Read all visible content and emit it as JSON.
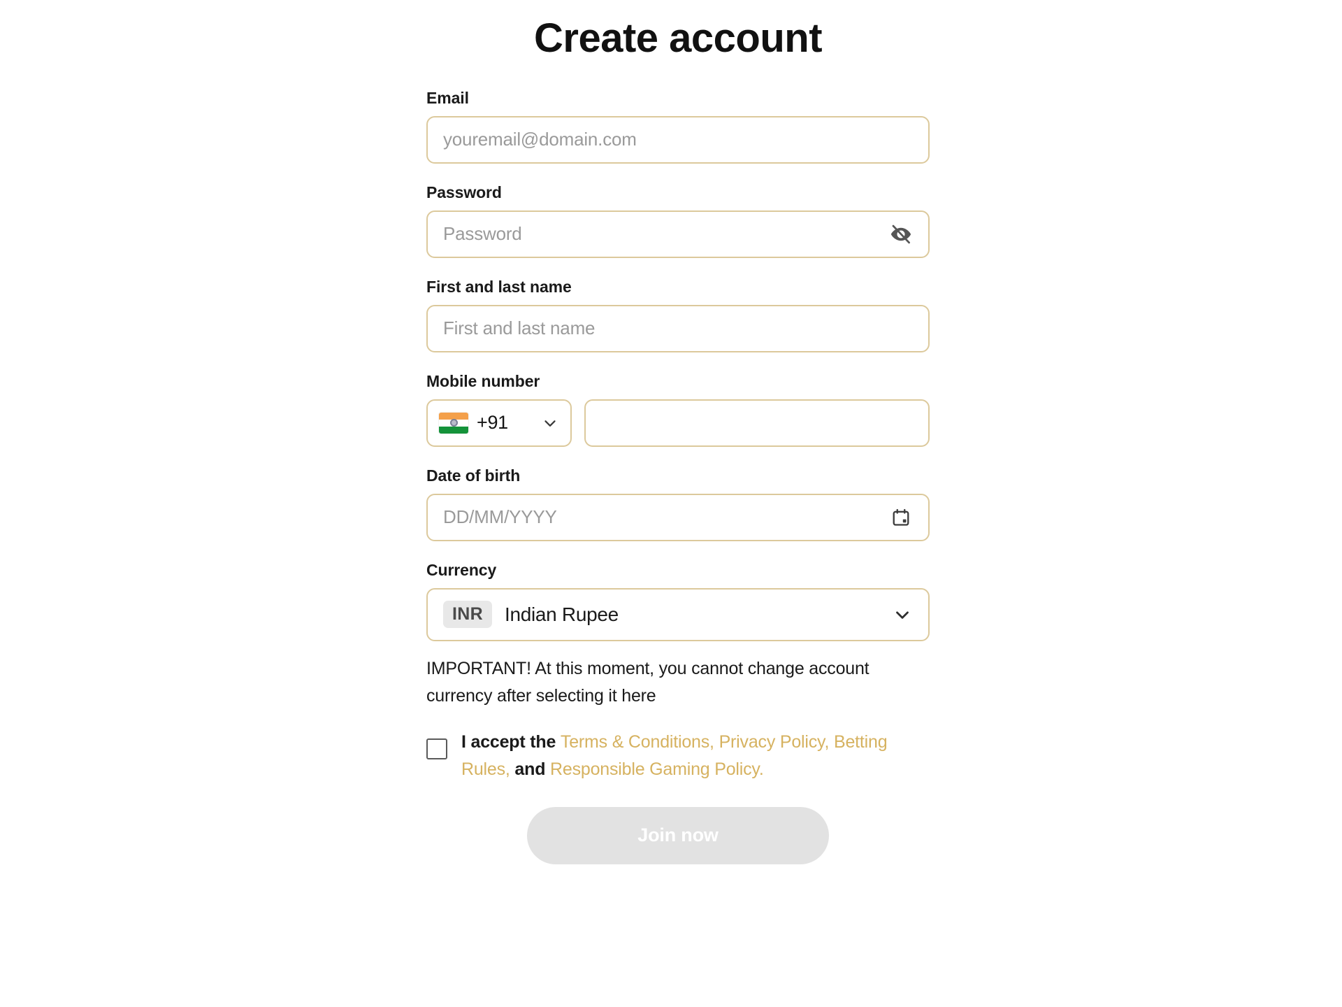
{
  "page": {
    "title": "Create account",
    "background_color": "#ffffff",
    "accent_border_color": "#dcc99c",
    "link_color": "#d6b260"
  },
  "fields": {
    "email": {
      "label": "Email",
      "placeholder": "youremail@domain.com",
      "value": ""
    },
    "password": {
      "label": "Password",
      "placeholder": "Password",
      "value": "",
      "toggle_icon": "eye-off-icon"
    },
    "full_name": {
      "label": "First and last name",
      "placeholder": "First and last name",
      "value": ""
    },
    "mobile": {
      "label": "Mobile number",
      "country_flag": "india-flag-icon",
      "dial_code": "+91",
      "dropdown_icon": "chevron-down-icon",
      "number_value": "",
      "number_placeholder": ""
    },
    "date_of_birth": {
      "label": "Date of birth",
      "placeholder": "DD/MM/YYYY",
      "value": "",
      "icon": "calendar-icon"
    },
    "currency": {
      "label": "Currency",
      "code": "INR",
      "name": "Indian Rupee",
      "dropdown_icon": "chevron-down-icon"
    }
  },
  "notice": {
    "text": "IMPORTANT! At this moment, you cannot change account currency after selecting it here"
  },
  "terms": {
    "checked": false,
    "lead": "I accept the ",
    "link_terms": "Terms & Conditions,",
    "sep1": " ",
    "link_privacy": "Privacy Policy,",
    "link_betting": "Betting Rules,",
    "and": " and ",
    "link_gaming": "Responsible Gaming Policy."
  },
  "submit": {
    "label": "Join now",
    "enabled": false
  }
}
